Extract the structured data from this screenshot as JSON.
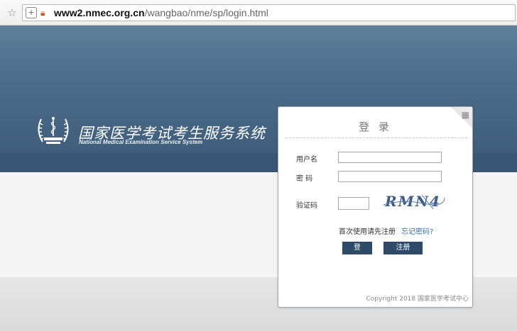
{
  "browser": {
    "url_host": "www2.nmec.org.cn",
    "url_path": "/wangbao/nme/sp/login.html"
  },
  "site": {
    "title": "国家医学考试考生服务系统",
    "subtitle": "National Medical Examination Service System"
  },
  "login": {
    "title": "登 录",
    "username_label": "用户名",
    "password_label": "密 码",
    "captcha_label": "验证码",
    "captcha_text": "RMN4",
    "first_use_text": "首次使用请先注册",
    "forgot_password": "忘记密码?",
    "login_button": "登入",
    "register_button": "注册",
    "copyright": "Copyright 2018 国家医学考试中心"
  },
  "colors": {
    "banner": "#4e6e8c",
    "button": "#2f4a68",
    "link": "#3a6ea5"
  },
  "icons": {
    "favorite": "star-icon",
    "add": "plus-icon",
    "security": "lock-warning-icon",
    "qr": "qr-code-icon"
  }
}
